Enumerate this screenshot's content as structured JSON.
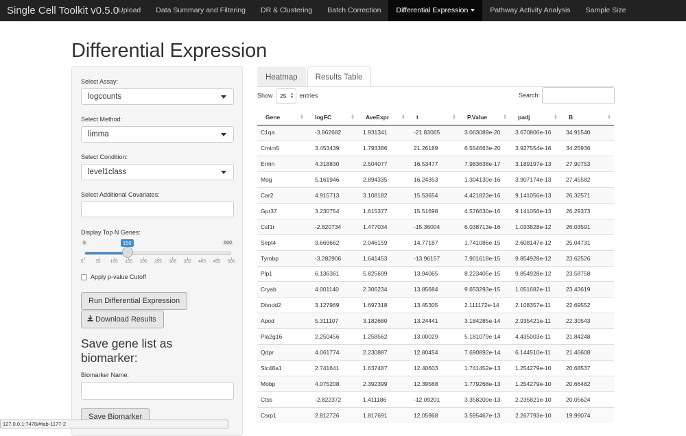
{
  "app": {
    "brand": "Single Cell Toolkit v0.5.0"
  },
  "nav": {
    "items": [
      {
        "label": "Upload"
      },
      {
        "label": "Data Summary and Filtering"
      },
      {
        "label": "DR & Clustering"
      },
      {
        "label": "Batch Correction"
      },
      {
        "label": "Differential Expression",
        "active": true,
        "dropdown": true
      },
      {
        "label": "Pathway Activity Analysis"
      },
      {
        "label": "Sample Size"
      }
    ]
  },
  "page": {
    "title": "Differential Expression"
  },
  "sidebar": {
    "assay": {
      "label": "Select Assay:",
      "value": "logcounts"
    },
    "method": {
      "label": "Select Method:",
      "value": "limma"
    },
    "condition": {
      "label": "Select Condition:",
      "value": "level1class"
    },
    "covariates": {
      "label": "Select Additional Covariates:",
      "value": ""
    },
    "topn": {
      "label": "Display Top N Genes:",
      "min": "5",
      "max": "500",
      "value": "150",
      "value_fraction": 0.293,
      "ticks": [
        "5",
        "55",
        "105",
        "155",
        "205",
        "255",
        "305",
        "355",
        "405",
        "455",
        "500"
      ]
    },
    "pvalue_checkbox": {
      "label": "Apply p-value Cutoff",
      "checked": false
    },
    "run_button": "Run Differential Expression",
    "download_button": "Download Results",
    "biomarker": {
      "heading": "Save gene list as biomarker:",
      "name_label": "Biomarker Name:",
      "name_value": "",
      "save_button": "Save Biomarker"
    }
  },
  "tabs": [
    {
      "label": "Heatmap",
      "active": false
    },
    {
      "label": "Results Table",
      "active": true
    }
  ],
  "table_controls": {
    "show_label": "Show",
    "entries_value": "25",
    "entries_label": "entries",
    "search_label": "Search:",
    "search_value": ""
  },
  "results": {
    "columns": [
      "Gene",
      "logFC",
      "AveExpr",
      "t",
      "P.Value",
      "padj",
      "B"
    ],
    "rows": [
      [
        "C1qa",
        "-3.862682",
        "1.931341",
        "-21.83065",
        "3.063089e-20",
        "3.670806e-16",
        "34.91540"
      ],
      [
        "Cmtm5",
        "3.453439",
        "1.793386",
        "21.26189",
        "6.554663e-20",
        "3.927554e-16",
        "34.25936"
      ],
      [
        "Ermn",
        "4.318830",
        "2.504077",
        "16.53477",
        "7.983638e-17",
        "3.189197e-13",
        "27.90753"
      ],
      [
        "Mog",
        "5.161946",
        "2.894335",
        "16.24353",
        "1.304130e-16",
        "3.907174e-13",
        "27.45582"
      ],
      [
        "Car2",
        "4.915713",
        "3.108182",
        "15.53654",
        "4.421823e-16",
        "9.141056e-13",
        "26.32571"
      ],
      [
        "Gpr37",
        "3.230754",
        "1.615377",
        "15.51698",
        "4.576630e-16",
        "9.141056e-13",
        "26.29373"
      ],
      [
        "Csf1r",
        "-2.820734",
        "1.477034",
        "-15.36004",
        "6.038713e-16",
        "1.033828e-12",
        "26.03591"
      ],
      [
        "Sept4",
        "3.669662",
        "2.046159",
        "14.77187",
        "1.741086e-15",
        "2.608147e-12",
        "25.04731"
      ],
      [
        "Tyrobp",
        "-3.282906",
        "1.641453",
        "-13.96157",
        "7.901618e-15",
        "9.854928e-12",
        "23.62526"
      ],
      [
        "Plp1",
        "6.136361",
        "5.825699",
        "13.94065",
        "8.223405e-15",
        "9.854928e-12",
        "23.58758"
      ],
      [
        "Cryab",
        "4.001140",
        "2.306234",
        "13.85684",
        "9.653293e-15",
        "1.051682e-11",
        "23.43619"
      ],
      [
        "Dbndd2",
        "3.127969",
        "1.697318",
        "13.45305",
        "2.111172e-14",
        "2.108357e-11",
        "22.69552"
      ],
      [
        "Apod",
        "5.311107",
        "3.182680",
        "13.24441",
        "3.184285e-14",
        "2.935421e-11",
        "22.30543"
      ],
      [
        "Pla2g16",
        "2.250456",
        "1.258562",
        "13.00029",
        "5.181079e-14",
        "4.435003e-11",
        "21.84248"
      ],
      [
        "Qdpr",
        "4.061774",
        "2.230887",
        "12.80454",
        "7.690892e-14",
        "6.144510e-11",
        "21.46608"
      ],
      [
        "Slc48a1",
        "2.741641",
        "1.637487",
        "12.40603",
        "1.741452e-13",
        "1.254279e-10",
        "20.68537"
      ],
      [
        "Mobp",
        "4.075208",
        "2.392399",
        "12.39568",
        "1.779268e-13",
        "1.254279e-10",
        "20.66482"
      ],
      [
        "Ctss",
        "-2.822372",
        "1.411186",
        "-12.09201",
        "3.358209e-13",
        "2.235821e-10",
        "20.05624"
      ],
      [
        "Csrp1",
        "2.812726",
        "1.817691",
        "12.05968",
        "3.595467e-13",
        "2.267793e-10",
        "19.99074"
      ]
    ]
  },
  "statusbar": {
    "url": "127.0.0.1:7478/#tab-1177-2"
  },
  "colors": {
    "navbar": "#222222",
    "accent": "#428bca",
    "sidebar_bg": "#f5f5f5"
  }
}
